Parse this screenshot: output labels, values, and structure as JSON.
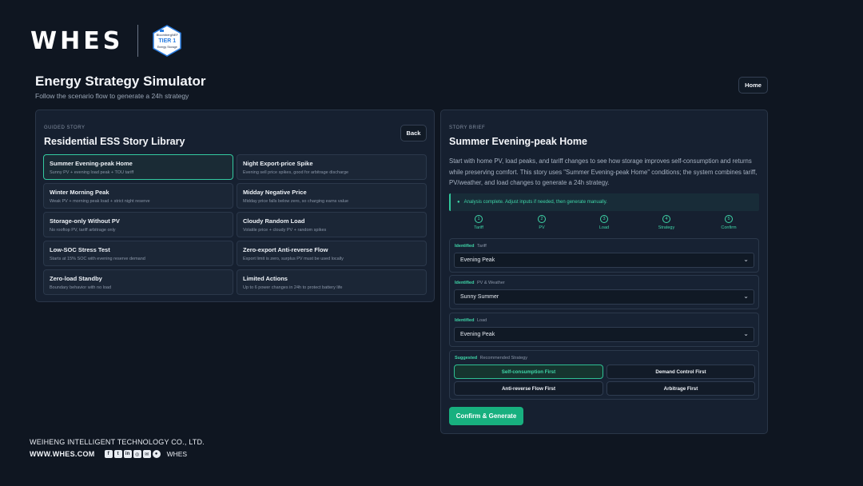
{
  "brand": {
    "logo_text": "WHES",
    "badge_line1": "BloombergNEF",
    "badge_tier": "TIER 1",
    "badge_sub": "Energy Storage"
  },
  "header": {
    "title": "Energy Strategy Simulator",
    "subtitle": "Follow the scenario flow to generate a 24h strategy",
    "home_label": "Home"
  },
  "library": {
    "eyebrow": "GUIDED STORY",
    "title": "Residential ESS Story Library",
    "back_label": "Back",
    "stories": [
      {
        "title": "Summer Evening-peak Home",
        "desc": "Sunny PV + evening load peak + TOU tariff",
        "active": true
      },
      {
        "title": "Night Export-price Spike",
        "desc": "Evening sell price spikes, good for arbitrage discharge",
        "active": false
      },
      {
        "title": "Winter Morning Peak",
        "desc": "Weak PV + morning peak load + strict night reserve",
        "active": false
      },
      {
        "title": "Midday Negative Price",
        "desc": "Midday price falls below zero, so charging earns value",
        "active": false
      },
      {
        "title": "Storage-only Without PV",
        "desc": "No rooftop PV, tariff arbitrage only",
        "active": false
      },
      {
        "title": "Cloudy Random Load",
        "desc": "Volatile price + cloudy PV + random spikes",
        "active": false
      },
      {
        "title": "Low-SOC Stress Test",
        "desc": "Starts at 15% SOC with evening reserve demand",
        "active": false
      },
      {
        "title": "Zero-export Anti-reverse Flow",
        "desc": "Export limit is zero, surplus PV must be used locally",
        "active": false
      },
      {
        "title": "Zero-load Standby",
        "desc": "Boundary behavior with no load",
        "active": false
      },
      {
        "title": "Limited Actions",
        "desc": "Up to 6 power changes in 24h to protect battery life",
        "active": false
      }
    ]
  },
  "brief": {
    "eyebrow": "STORY BRIEF",
    "title": "Summer Evening-peak Home",
    "text": "Start with home PV, load peaks, and tariff changes to see how storage improves self-consumption and returns while preserving comfort. This story uses \"Summer Evening-peak Home\" conditions; the system combines tariff, PV/weather, and load changes to generate a 24h strategy.",
    "notice": "Analysis complete. Adjust inputs if needed, then generate manually.",
    "steps": [
      {
        "num": "1",
        "label": "Tariff"
      },
      {
        "num": "2",
        "label": "PV"
      },
      {
        "num": "3",
        "label": "Load"
      },
      {
        "num": "4",
        "label": "Strategy"
      },
      {
        "num": "5",
        "label": "Confirm"
      }
    ],
    "fields": {
      "tariff": {
        "tag": "Identified",
        "name": "Tariff",
        "value": "Evening Peak"
      },
      "pv": {
        "tag": "Identified",
        "name": "PV & Weather",
        "value": "Sunny Summer"
      },
      "load": {
        "tag": "Identified",
        "name": "Load",
        "value": "Evening Peak"
      }
    },
    "strategy": {
      "tag": "Suggested",
      "name": "Recommended Strategy",
      "options": [
        "Self-consumption First",
        "Demand Control First",
        "Anti-reverse Flow First",
        "Arbitrage First"
      ],
      "selected": "Self-consumption First"
    },
    "generate_label": "Confirm & Generate"
  },
  "footer": {
    "company": "WEIHENG INTELLIGENT TECHNOLOGY CO., LTD.",
    "website": "WWW.WHES.COM",
    "social_icons": [
      "facebook-icon",
      "twitter-icon",
      "linkedin-icon",
      "instagram-icon",
      "wechat-icon",
      "weibo-icon"
    ],
    "brand_small": "WHES"
  },
  "colors": {
    "background": "#0f1621",
    "panel": "#162030",
    "accent": "#34c9a0",
    "button_green": "#18b07f"
  }
}
